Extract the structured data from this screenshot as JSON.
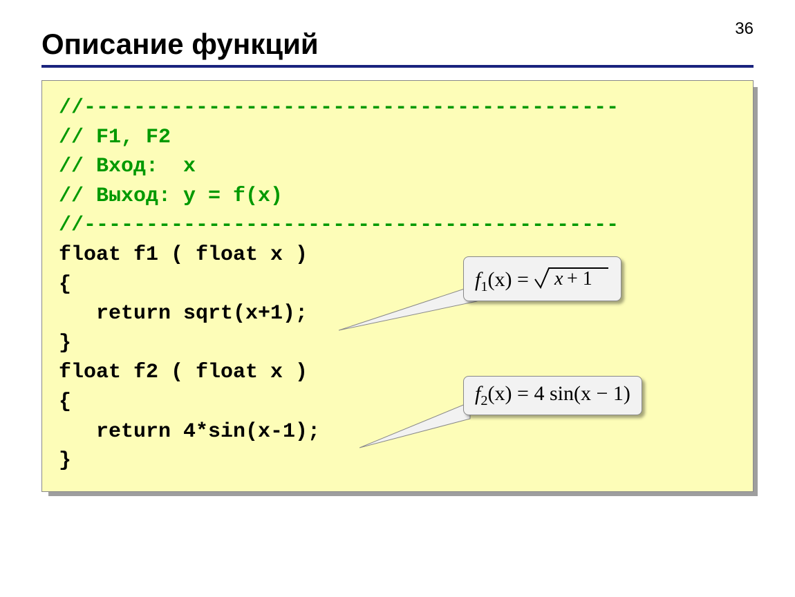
{
  "page_number": "36",
  "title": "Описание функций",
  "code": {
    "c1": "//-------------------------------------------",
    "c2": "// F1, F2",
    "c3": "// Вход:  x",
    "c4": "// Выход: y = f(x)",
    "c5": "//-------------------------------------------",
    "l6": "float f1 ( float x )",
    "l7": "{",
    "l8": "   return sqrt(x+1);",
    "l9": "}",
    "l10": "float f2 ( float x )",
    "l11": "{",
    "l12": "   return 4*sin(x-1);",
    "l13": "}"
  },
  "callouts": {
    "f1": {
      "prefix": "f",
      "sub": "1",
      "afterSub": "(x) = ",
      "radicand": "x + 1"
    },
    "f2": {
      "prefix": "f",
      "sub": "2",
      "rest": "(x) = 4 sin(x − 1)"
    }
  }
}
